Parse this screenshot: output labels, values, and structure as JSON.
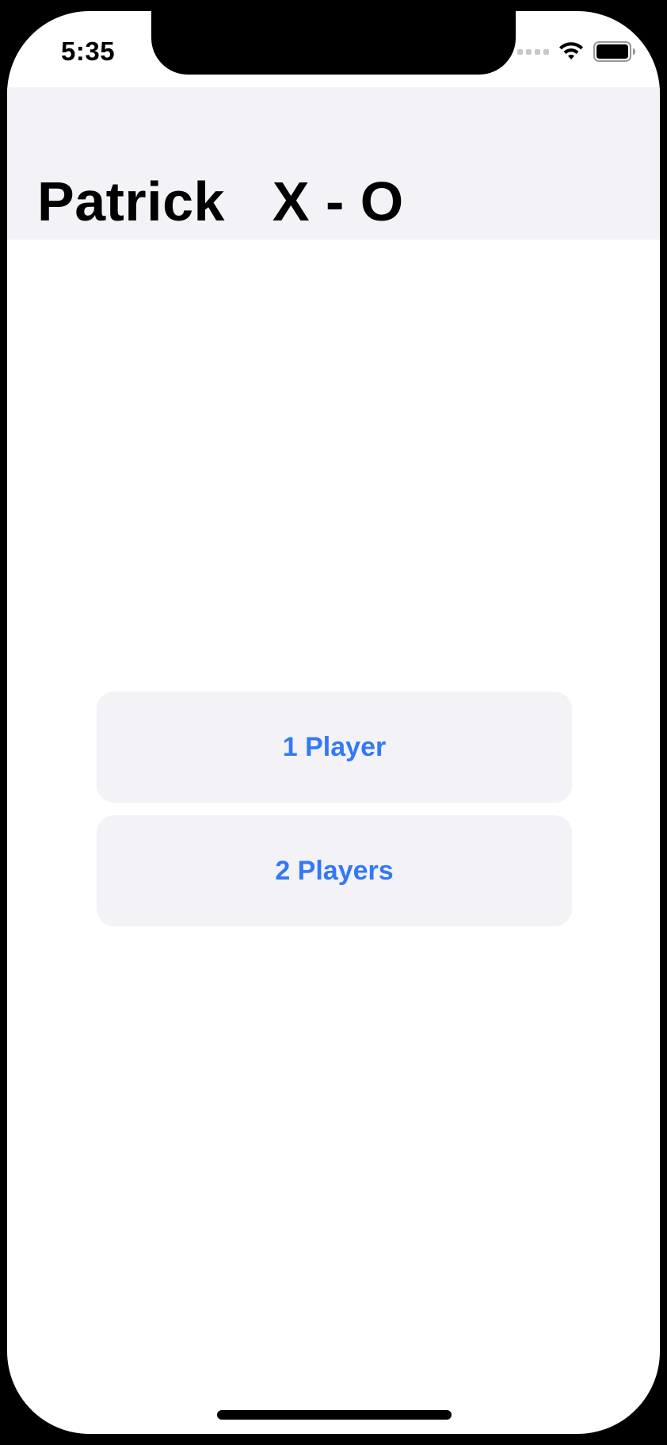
{
  "status_bar": {
    "time": "5:35",
    "icons": [
      "cellular-signal-icon",
      "wifi-icon",
      "battery-icon"
    ]
  },
  "nav": {
    "title": "Patrick   X - O"
  },
  "buttons": {
    "one_player": "1 Player",
    "two_players": "2 Players"
  },
  "colors": {
    "accent": "#3478f6",
    "button_background": "#f2f2f7",
    "navbar_background": "#f2f2f7",
    "text": "#000000"
  }
}
